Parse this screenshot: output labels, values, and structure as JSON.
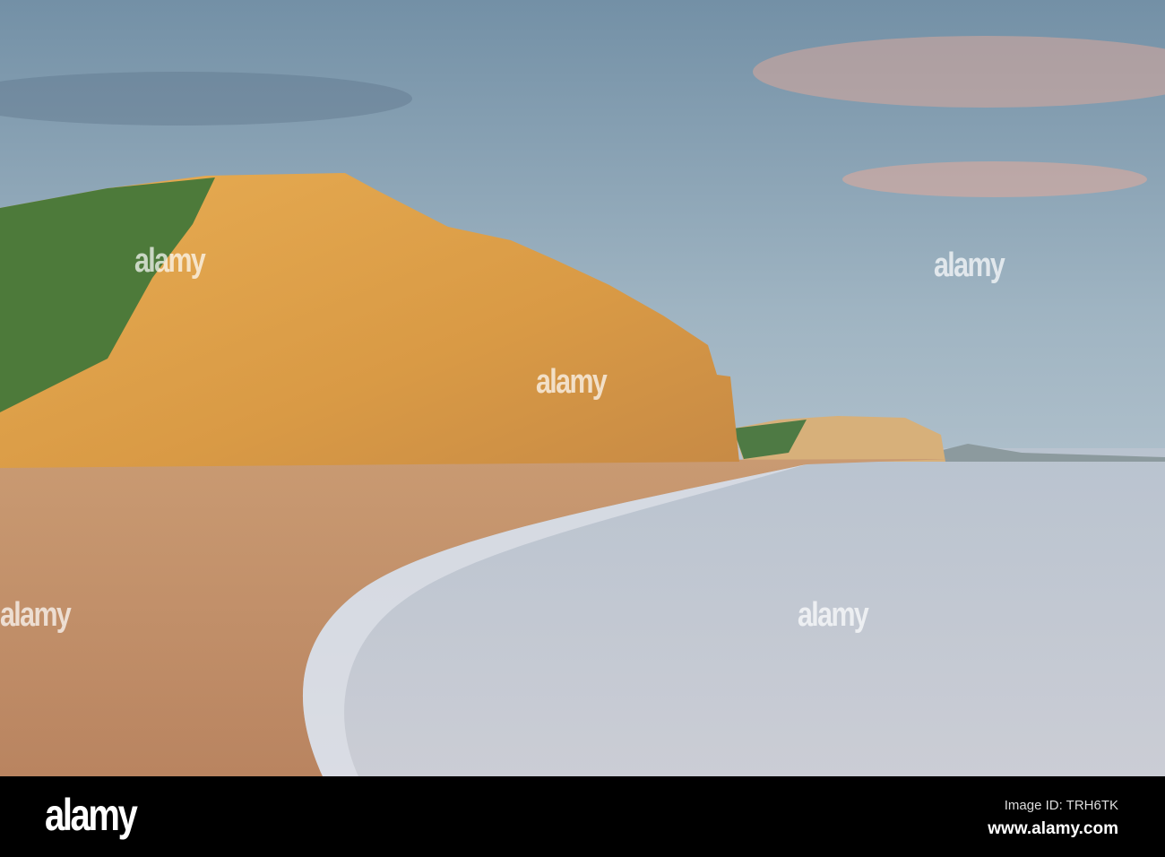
{
  "watermark": {
    "text": "alamy"
  },
  "footer": {
    "logo": "alamy",
    "image_id": "Image ID: TRH6TK",
    "url": "www.alamy.com"
  },
  "colors": {
    "sky_top": "#6f8aa0",
    "sky_bottom": "#c9d3dc",
    "cliff": "#e0a24a",
    "grass": "#4d7a3a",
    "sand": "#c8946a",
    "sea": "#c6cbd4",
    "footer": "#000000"
  }
}
